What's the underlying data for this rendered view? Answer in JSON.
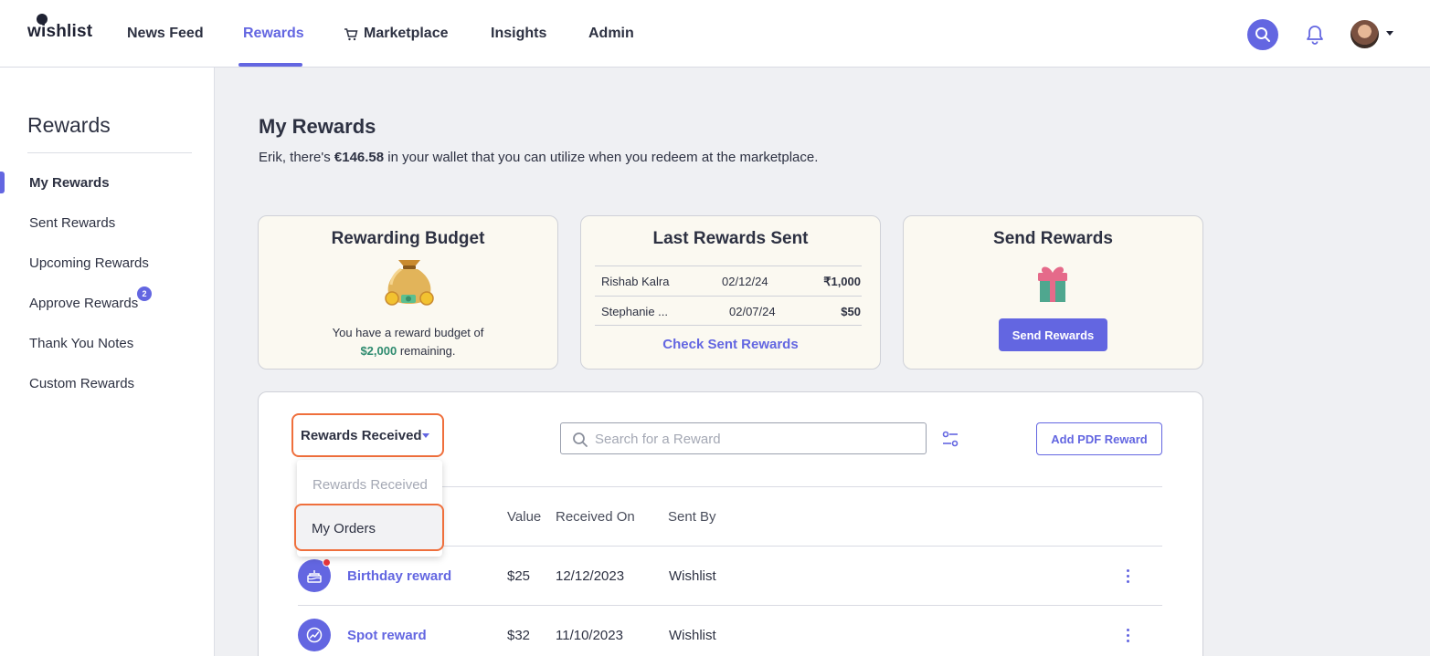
{
  "topnav": {
    "logo": "wishlist",
    "items": [
      {
        "label": "News Feed"
      },
      {
        "label": "Rewards"
      },
      {
        "label": "Marketplace"
      },
      {
        "label": "Insights"
      },
      {
        "label": "Admin"
      }
    ],
    "active": "Rewards",
    "icons": [
      "search-icon",
      "bell-icon",
      "cart-icon",
      "avatar",
      "caret-down-icon"
    ]
  },
  "sidebar": {
    "title": "Rewards",
    "items": [
      {
        "label": "My Rewards"
      },
      {
        "label": "Sent Rewards"
      },
      {
        "label": "Upcoming Rewards"
      },
      {
        "label": "Approve Rewards",
        "badge": "2"
      },
      {
        "label": "Thank You Notes"
      },
      {
        "label": "Custom Rewards"
      }
    ],
    "active": "My Rewards"
  },
  "main": {
    "title": "My Rewards",
    "wallet": {
      "prefix": "Erik, there's ",
      "amount": "€146.58",
      "suffix": " in your wallet that you can utilize when you redeem at the marketplace."
    }
  },
  "cards": {
    "budget": {
      "title": "Rewarding Budget",
      "text": "You have a reward budget of",
      "amount": "$2,000",
      "suffix": " remaining."
    },
    "last_sent": {
      "title": "Last Rewards Sent",
      "rows": [
        {
          "name": "Rishab Kalra",
          "date": "02/12/24",
          "amount": "₹1,000"
        },
        {
          "name": "Stephanie ...",
          "date": "02/07/24",
          "amount": "$50"
        }
      ],
      "link": "Check Sent Rewards"
    },
    "send": {
      "title": "Send Rewards",
      "button": "Send Rewards"
    }
  },
  "rewards_panel": {
    "dropdown_label": "Rewards Received",
    "dropdown_options": [
      "Rewards Received",
      "My Orders"
    ],
    "search_placeholder": "Search for a Reward",
    "add_pdf_button": "Add PDF Reward",
    "columns": [
      "Value",
      "Received On",
      "Sent By"
    ],
    "rows": [
      {
        "name": "Birthday reward",
        "value": "$25",
        "received_on": "12/12/2023",
        "sent_by": "Wishlist",
        "icon": "cake-icon",
        "unread": true
      },
      {
        "name": "Spot reward",
        "value": "$32",
        "received_on": "11/10/2023",
        "sent_by": "Wishlist",
        "icon": "trend-chart-icon",
        "unread": false
      }
    ]
  },
  "colors": {
    "accent": "#6366e1",
    "highlight_outline": "#ef6f3c",
    "budget_amount": "#2e8b6f",
    "notification": "#e8363d"
  }
}
